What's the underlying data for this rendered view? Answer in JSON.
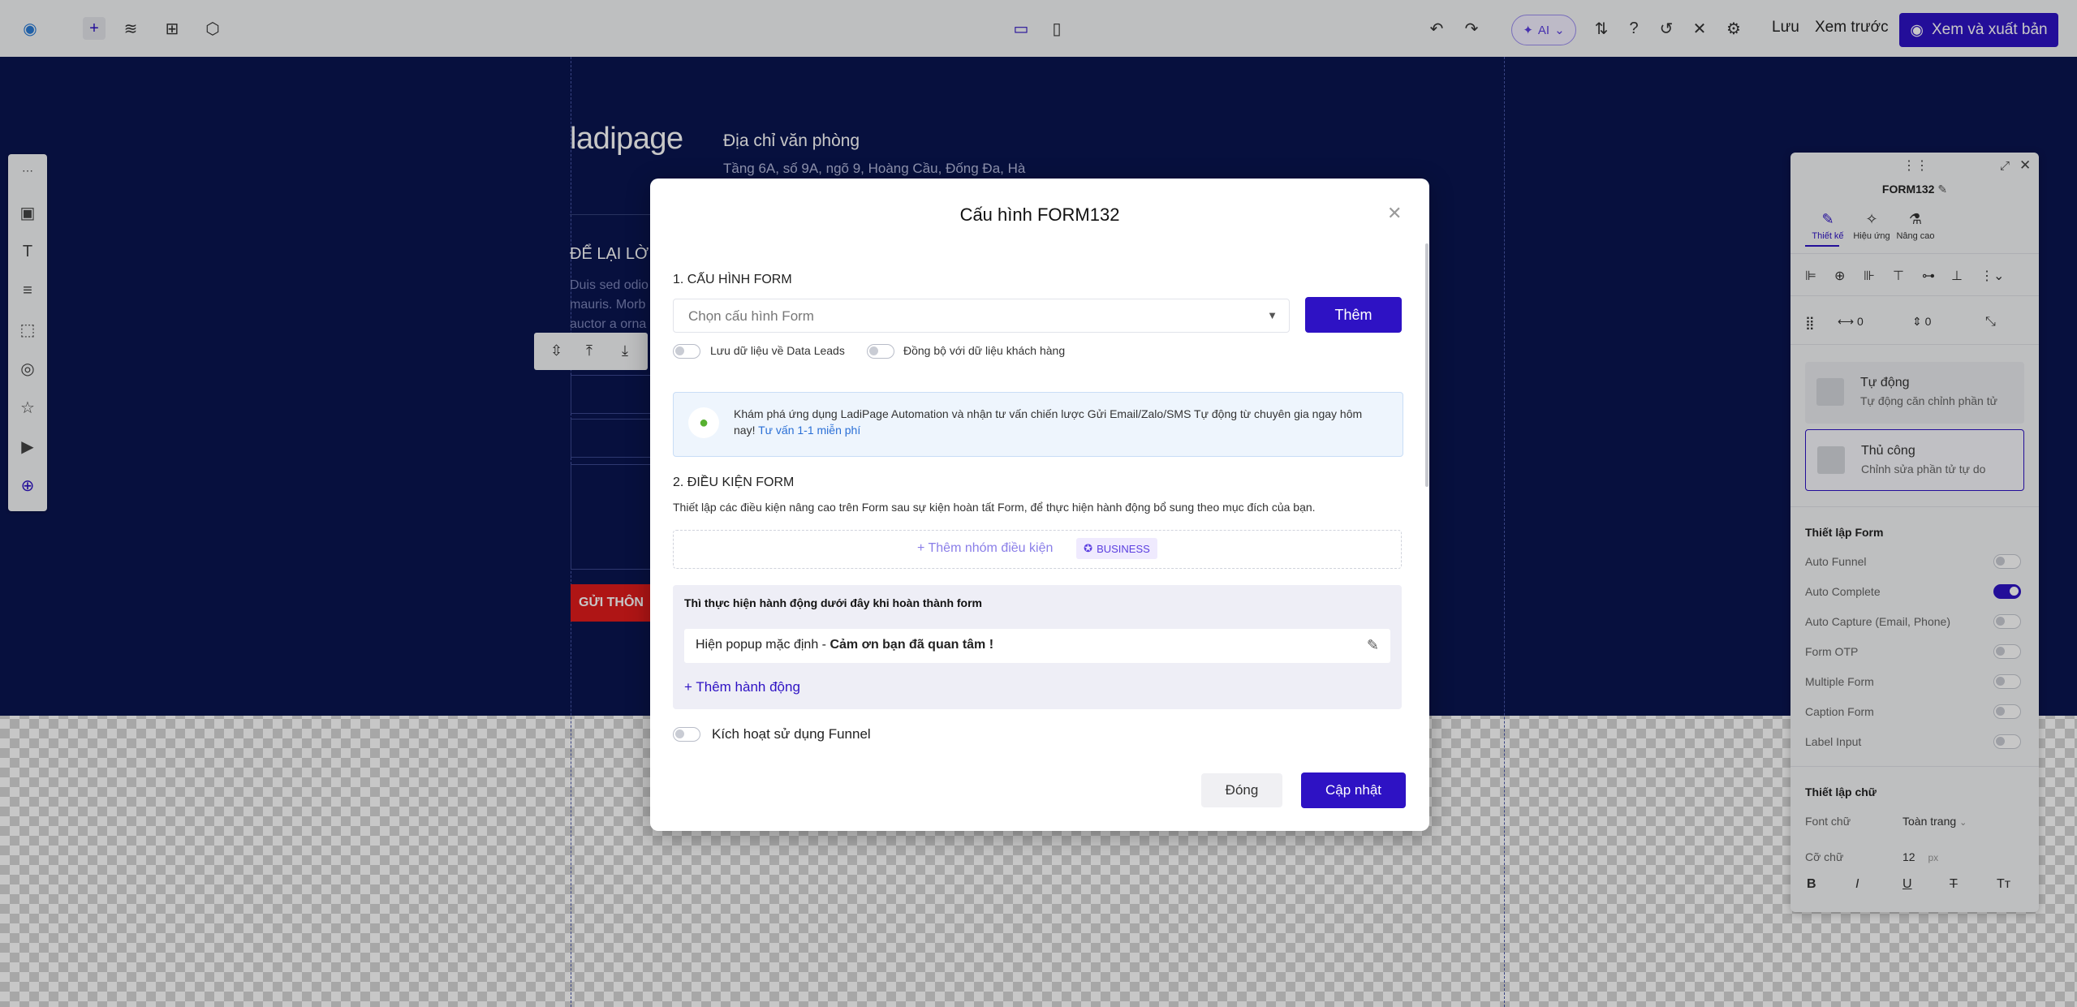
{
  "topbar": {
    "ai_label": "AI",
    "save_label": "Lưu",
    "preview_label": "Xem trước",
    "publish_label": "Xem và xuất bản"
  },
  "page": {
    "logo_text": "ladipage",
    "office_title": "Địa chỉ văn phòng",
    "office_address": "Tầng 6A, số 9A, ngõ 9, Hoàng Cầu, Đống Đa, Hà",
    "contact_heading": "ĐỂ LẠI LỜI",
    "contact_body": [
      "Duis sed odio",
      "mauris. Morb",
      "auctor a orna"
    ],
    "submit_label": "GỬI THÔN"
  },
  "modal": {
    "title": "Cấu hình FORM132",
    "section1": "1. CẤU HÌNH FORM",
    "select_placeholder": "Chọn cấu hình Form",
    "add_label": "Thêm",
    "toggle_leads": "Lưu dữ liệu về Data Leads",
    "toggle_sync": "Đồng bộ với dữ liệu khách hàng",
    "info_text": "Khám phá ứng dụng LadiPage Automation và nhận tư vấn chiến lược Gửi Email/Zalo/SMS Tự động từ chuyên gia ngay hôm nay!",
    "info_link": "Tư vấn 1-1 miễn phí",
    "section2": "2. ĐIỀU KIỆN FORM",
    "section2_desc": "Thiết lập các điều kiện nâng cao trên Form sau sự kiện hoàn tất Form, để thực hiện hành động bổ sung theo mục đích của bạn.",
    "add_condition": "Thêm nhóm điều kiện",
    "business_badge": "BUSINESS",
    "action_title": "Thì thực hiện hành động dưới đây khi hoàn thành form",
    "action_prefix": "Hiện popup mặc định - ",
    "action_value": "Cảm ơn bạn đã quan tâm !",
    "add_action": "Thêm hành động",
    "funnel_label": "Kích hoạt sử dụng Funnel",
    "close_label": "Đóng",
    "update_label": "Cập nhật"
  },
  "panel": {
    "title": "FORM132",
    "tabs": [
      "Thiết kế",
      "Hiệu ứng",
      "Nâng cao"
    ],
    "spacing_a": "0",
    "spacing_b": "0",
    "mode_auto_title": "Tự động",
    "mode_auto_sub": "Tự động căn chỉnh phần tử",
    "mode_manual_title": "Thủ công",
    "mode_manual_sub": "Chỉnh sửa phần tử tự do",
    "form_settings": "Thiết lập Form",
    "form_options": [
      {
        "label": "Auto Funnel",
        "on": false
      },
      {
        "label": "Auto Complete",
        "on": true
      },
      {
        "label": "Auto Capture (Email, Phone)",
        "on": false
      },
      {
        "label": "Form OTP",
        "on": false
      },
      {
        "label": "Multiple Form",
        "on": false
      },
      {
        "label": "Caption Form",
        "on": false
      },
      {
        "label": "Label Input",
        "on": false
      }
    ],
    "text_settings": "Thiết lập chữ",
    "font_label": "Font chữ",
    "font_value": "Toàn trang",
    "size_label": "Cỡ chữ",
    "size_value": "12",
    "size_unit": "px"
  },
  "colors": {
    "accent": "#2e12c4",
    "canvas_navy": "#0a1550",
    "toggle_on": "#2e12c4"
  }
}
